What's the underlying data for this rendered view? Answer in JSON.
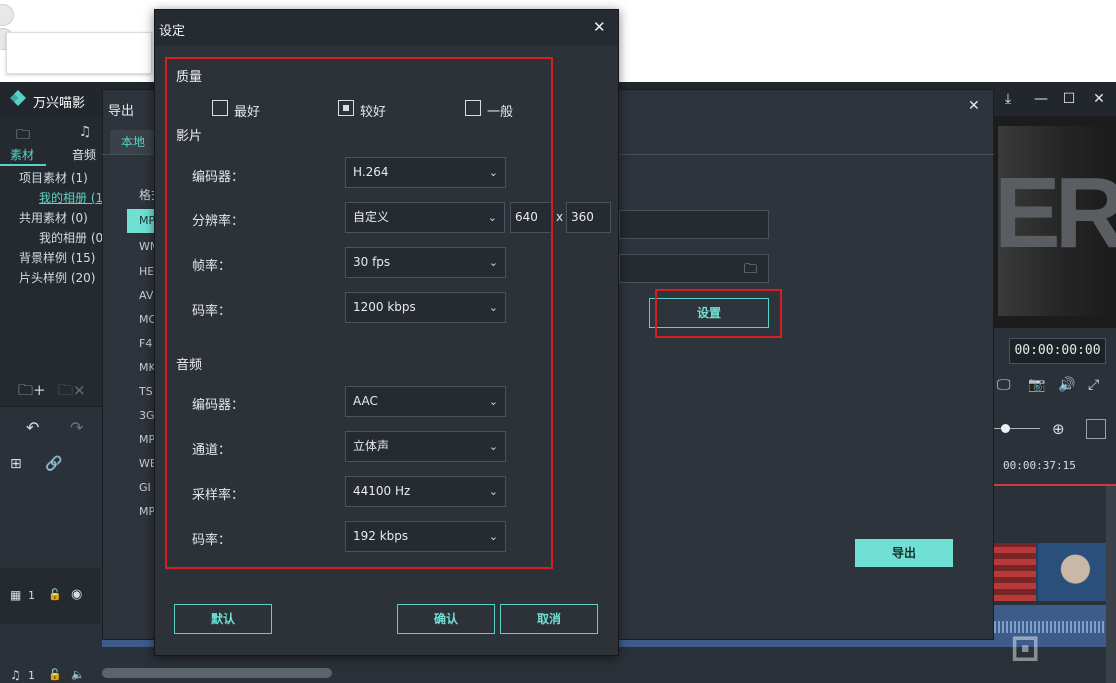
{
  "app": {
    "title": "万兴喵影"
  },
  "library": {
    "tabs": [
      "素材",
      "音频"
    ],
    "tree": [
      "项目素材 (1)",
      "我的相册 (1",
      "共用素材 (0)",
      "我的相册 (0",
      "背景样例 (15)",
      "片头样例 (20)"
    ],
    "selected_index": 1
  },
  "export": {
    "title": "导出",
    "tab_local": "本地",
    "format_label": "格式",
    "formats": [
      "MP",
      "WM",
      "HE",
      "AV",
      "MO",
      "F4",
      "MK",
      "TS",
      "3G",
      "MP",
      "WE",
      "GI",
      "MP"
    ],
    "settings_button": "设置",
    "export_button": "导出"
  },
  "player": {
    "timecode": "00:00:00:00",
    "ruler_time": "00:00:37:15"
  },
  "tracks": {
    "video_label": "1",
    "audio_label": "1"
  },
  "settings": {
    "title": "设定",
    "quality": {
      "heading": "质量",
      "options": [
        "最好",
        "较好",
        "一般"
      ],
      "selected": 1
    },
    "video": {
      "heading": "影片",
      "encoder_label": "编码器：",
      "encoder_value": "H.264",
      "resolution_label": "分辨率：",
      "resolution_value": "自定义",
      "width": "640",
      "height": "360",
      "x_sep": "x",
      "framerate_label": "帧率：",
      "framerate_value": "30 fps",
      "bitrate_label": "码率：",
      "bitrate_value": "1200 kbps"
    },
    "audio": {
      "heading": "音频",
      "encoder_label": "编码器：",
      "encoder_value": "AAC",
      "channel_label": "通道：",
      "channel_value": "立体声",
      "samplerate_label": "采样率：",
      "samplerate_value": "44100 Hz",
      "bitrate_label": "码率：",
      "bitrate_value": "192 kbps"
    },
    "buttons": {
      "default": "默认",
      "confirm": "确认",
      "cancel": "取消"
    }
  },
  "colors": {
    "accent": "#6fe0d3",
    "highlight": "#d61f1f"
  }
}
